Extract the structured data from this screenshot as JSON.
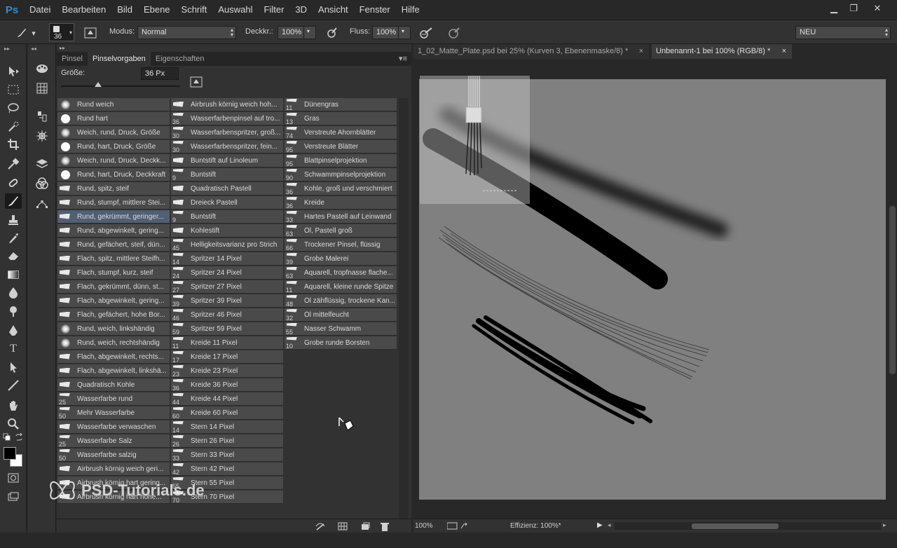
{
  "app": {
    "logo": "Ps"
  },
  "menu": [
    "Datei",
    "Bearbeiten",
    "Bild",
    "Ebene",
    "Schrift",
    "Auswahl",
    "Filter",
    "3D",
    "Ansicht",
    "Fenster",
    "Hilfe"
  ],
  "window_controls": {
    "minimize": "▁",
    "restore": "❐",
    "close": "✕"
  },
  "options": {
    "brush_size": "36",
    "mode_label": "Modus:",
    "mode_value": "Normal",
    "opacity_label": "Deckkr.:",
    "opacity_value": "100%",
    "flow_label": "Fluss:",
    "flow_value": "100%",
    "workspace": "NEU"
  },
  "panel": {
    "tabs": [
      "Pinsel",
      "Pinselvorgaben",
      "Eigenschaften"
    ],
    "active_tab": "Pinselvorgaben",
    "size_label": "Größe:",
    "size_value": "36 Px"
  },
  "brushes": {
    "col1": [
      {
        "name": "Rund weich",
        "type": "soft"
      },
      {
        "name": "Rund hart",
        "type": "hard"
      },
      {
        "name": "Weich, rund, Druck, Größe",
        "type": "soft"
      },
      {
        "name": "Rund, hart, Druck, Größe",
        "type": "hard"
      },
      {
        "name": "Weich, rund, Druck, Deckk...",
        "type": "soft"
      },
      {
        "name": "Rund, hart, Druck, Deckkraft",
        "type": "hard"
      },
      {
        "name": "Rund, spitz, steif",
        "type": "stroke"
      },
      {
        "name": "Rund, stumpf, mittlere Stei...",
        "type": "stroke"
      },
      {
        "name": "Rund, gekrümmt, geringer...",
        "type": "stroke",
        "selected": true
      },
      {
        "name": "Rund, abgewinkelt, gering...",
        "type": "stroke"
      },
      {
        "name": "Rund, gefächert, steif, dün...",
        "type": "stroke"
      },
      {
        "name": "Flach, spitz, mittlere Steifh...",
        "type": "stroke"
      },
      {
        "name": "Flach, stumpf, kurz, steif",
        "type": "stroke"
      },
      {
        "name": "Flach, gekrümmt, dünn, st...",
        "type": "stroke"
      },
      {
        "name": "Flach, abgewinkelt, gering...",
        "type": "stroke"
      },
      {
        "name": "Flach, gefächert, hohe Bor...",
        "type": "stroke"
      },
      {
        "name": "Rund, weich, linkshändig",
        "type": "soft"
      },
      {
        "name": "Rund, weich, rechtshändig",
        "type": "soft"
      },
      {
        "name": "Flach, abgewinkelt, rechts...",
        "type": "stroke"
      },
      {
        "name": "Flach, abgewinkelt, linkshä...",
        "type": "stroke"
      },
      {
        "name": "Quadratisch Kohle",
        "type": "stroke"
      },
      {
        "name": "Wasserfarbe rund",
        "num": "25"
      },
      {
        "name": "Mehr Wasserfarbe",
        "num": "50"
      },
      {
        "name": "Wasserfarbe verwaschen",
        "type": "stroke"
      },
      {
        "name": "Wasserfarbe Salz",
        "num": "25"
      },
      {
        "name": "Wasserfarbe salzig",
        "num": "50"
      },
      {
        "name": "Airbrush körnig weich geri...",
        "type": "stroke"
      },
      {
        "name": "Airbrush körnig hart gering...",
        "type": "stroke"
      },
      {
        "name": "Airbrush körnig hart hohe...",
        "type": "stroke"
      }
    ],
    "col2": [
      {
        "name": "Airbrush körnig weich hoh...",
        "type": "stroke"
      },
      {
        "name": "Wasserfarbenpinsel auf tro...",
        "num": "36"
      },
      {
        "name": "Wasserfarbenspritzer, groß...",
        "num": "30"
      },
      {
        "name": "Wasserfarbenspritzer, fein...",
        "num": "30"
      },
      {
        "name": "Buntstift auf Linoleum",
        "type": "stroke"
      },
      {
        "name": "Buntstift",
        "num": "9"
      },
      {
        "name": "Quadratisch Pastell",
        "type": "stroke"
      },
      {
        "name": "Dreieck Pastell",
        "type": "stroke"
      },
      {
        "name": "Buntstift",
        "num": "9"
      },
      {
        "name": "Kohlestift",
        "type": "stroke"
      },
      {
        "name": "Helligkeitsvarianz pro Strich",
        "num": "45"
      },
      {
        "name": "Spritzer 14 Pixel",
        "num": "14"
      },
      {
        "name": "Spritzer 24 Pixel",
        "num": "24"
      },
      {
        "name": "Spritzer 27 Pixel",
        "num": "27"
      },
      {
        "name": "Spritzer 39 Pixel",
        "num": "39"
      },
      {
        "name": "Spritzer 46 Pixel",
        "num": "46"
      },
      {
        "name": "Spritzer 59 Pixel",
        "num": "59"
      },
      {
        "name": "Kreide 11 Pixel",
        "num": "11"
      },
      {
        "name": "Kreide 17 Pixel",
        "num": "17"
      },
      {
        "name": "Kreide 23 Pixel",
        "num": "23"
      },
      {
        "name": "Kreide 36 Pixel",
        "num": "36"
      },
      {
        "name": "Kreide 44 Pixel",
        "num": "44"
      },
      {
        "name": "Kreide 60 Pixel",
        "num": "60"
      },
      {
        "name": "Stern 14 Pixel",
        "num": "14"
      },
      {
        "name": "Stern 26 Pixel",
        "num": "26"
      },
      {
        "name": "Stern 33 Pixel",
        "num": "33"
      },
      {
        "name": "Stern 42 Pixel",
        "num": "42"
      },
      {
        "name": "Stern 55 Pixel",
        "num": "55"
      },
      {
        "name": "Stern 70 Pixel",
        "num": "70"
      }
    ],
    "col3": [
      {
        "name": "Dünengras",
        "num": "11"
      },
      {
        "name": "Gras",
        "num": "13"
      },
      {
        "name": "Verstreute Ahornblätter",
        "num": "74"
      },
      {
        "name": "Verstreute Blätter",
        "num": "95"
      },
      {
        "name": "Blattpinselprojektion",
        "num": "95"
      },
      {
        "name": "Schwammpinselprojektion",
        "num": "90"
      },
      {
        "name": "Kohle, groß und verschmiert",
        "num": "36"
      },
      {
        "name": "Kreide",
        "num": "36"
      },
      {
        "name": "Hartes Pastell auf Leinwand",
        "num": "33"
      },
      {
        "name": "Öl, Pastell groß",
        "num": "63"
      },
      {
        "name": "Trockener Pinsel, flüssig",
        "num": "66"
      },
      {
        "name": "Grobe Malerei",
        "num": "39"
      },
      {
        "name": "Aquarell, tropfnasse flache...",
        "num": "63"
      },
      {
        "name": "Aquarell, kleine runde Spitze",
        "num": "11"
      },
      {
        "name": "Öl zähflüssig, trockene Kan...",
        "num": "48"
      },
      {
        "name": "Öl mittelfeucht",
        "num": "32"
      },
      {
        "name": "Nasser Schwamm",
        "num": "55"
      },
      {
        "name": "Grobe runde Borsten",
        "num": "10"
      }
    ]
  },
  "documents": {
    "tabs": [
      {
        "title": "1_02_Matte_Plate.psd bei 25% (Kurven 3, Ebenenmaske/8) *",
        "active": false
      },
      {
        "title": "Unbenannt-1 bei 100% (RGB/8) *",
        "active": true
      }
    ],
    "close_glyph": "×"
  },
  "status": {
    "zoom": "100%",
    "efficiency": "Effizienz: 100%*"
  },
  "watermark": "PSD-Tutorials.de"
}
